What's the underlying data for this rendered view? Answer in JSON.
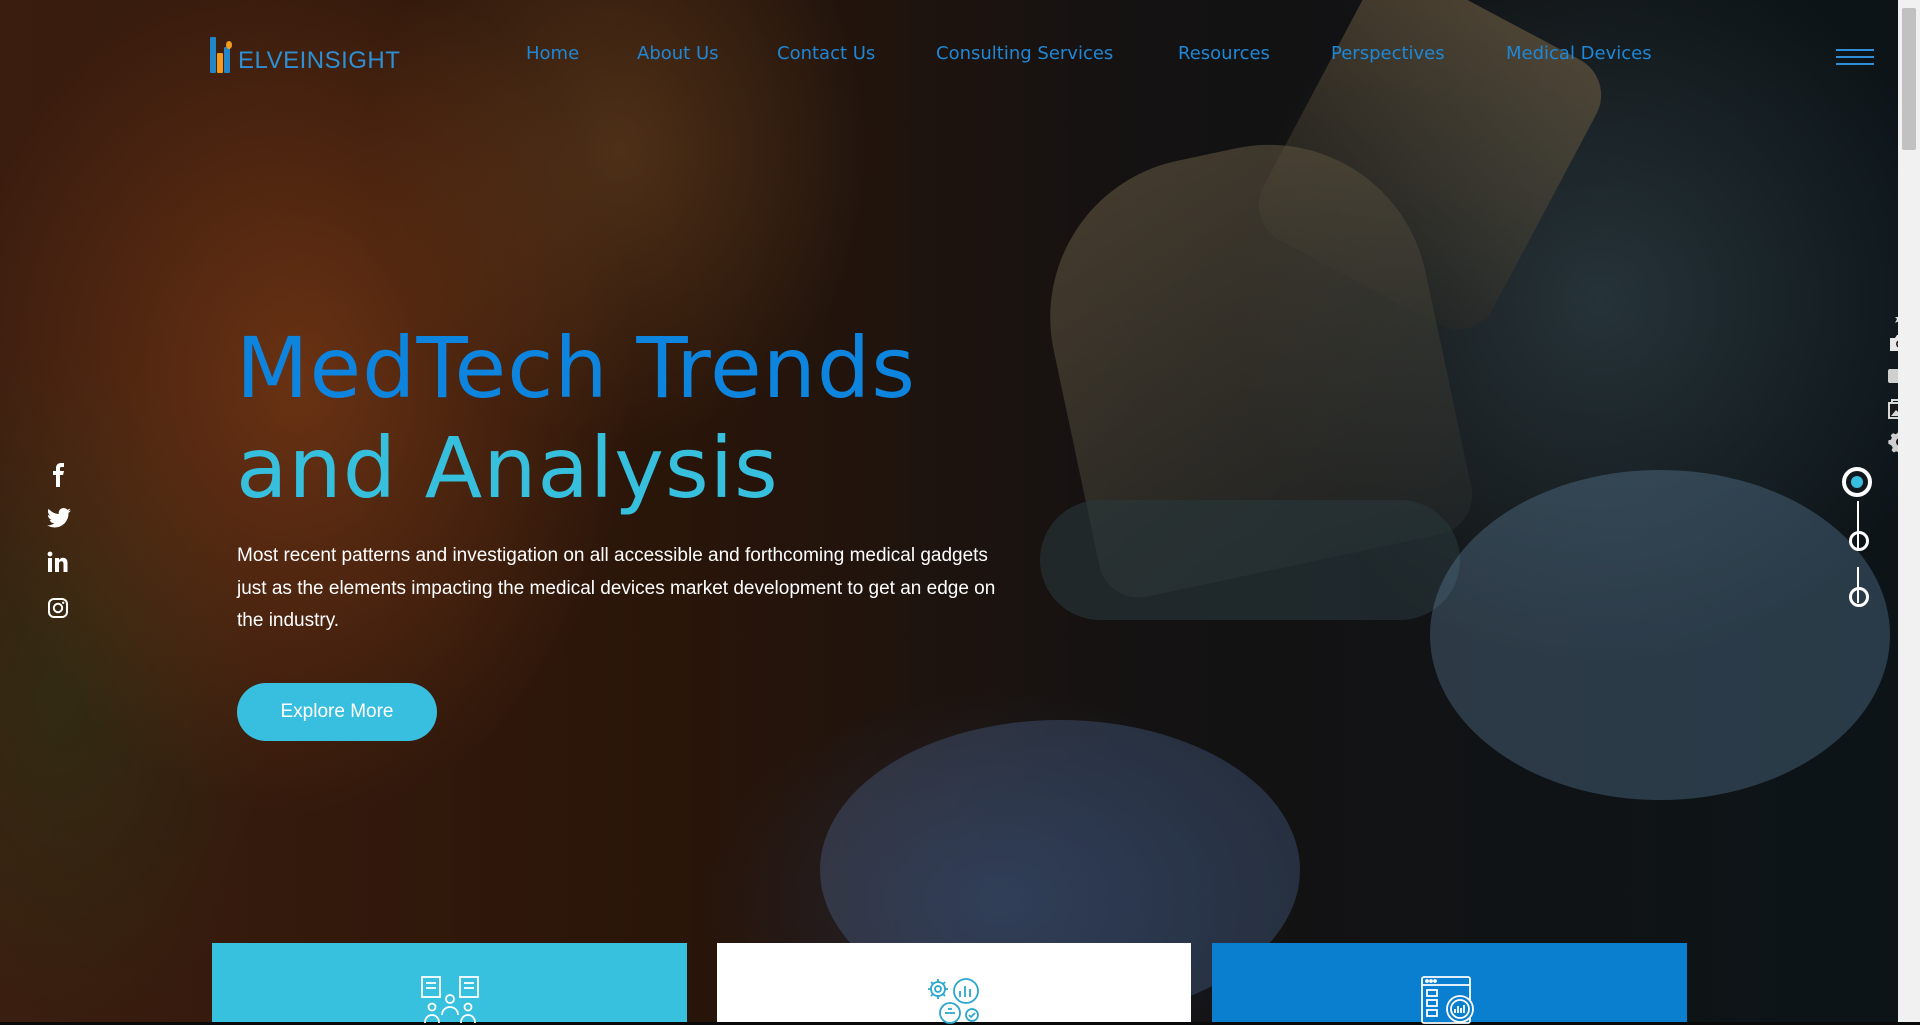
{
  "brand": {
    "logo_text": "ELVEINSIGHT",
    "logo_initial": "D",
    "primary_color": "#0d84dd",
    "accent_color": "#38bfdf",
    "orange": "#f39a1f"
  },
  "nav": {
    "items": [
      {
        "label": "Home"
      },
      {
        "label": "About Us"
      },
      {
        "label": "Contact Us"
      },
      {
        "label": "Consulting Services"
      },
      {
        "label": "Resources"
      },
      {
        "label": "Perspectives"
      },
      {
        "label": "Medical Devices"
      }
    ],
    "menu_icon": "hamburger-icon"
  },
  "hero": {
    "title_line1": "MedTech Trends",
    "title_line2": "and Analysis",
    "description": "Most recent patterns and investigation on all accessible and forthcoming medical gadgets just as the elements impacting the medical devices market development to get an edge on the industry.",
    "cta_label": "Explore More"
  },
  "social": [
    "facebook-icon",
    "twitter-icon",
    "linkedin-icon",
    "instagram-icon"
  ],
  "tools": [
    "pin-icon",
    "camera-icon",
    "video-icon",
    "gallery-icon",
    "gear-icon"
  ],
  "slider": {
    "count": 3,
    "active_index": 0
  },
  "cards": [
    {
      "icon": "team-documents-icon",
      "background": "#38c1df"
    },
    {
      "icon": "analytics-gears-icon",
      "background": "#ffffff"
    },
    {
      "icon": "dashboard-report-icon",
      "background": "#0b7fcf"
    }
  ]
}
